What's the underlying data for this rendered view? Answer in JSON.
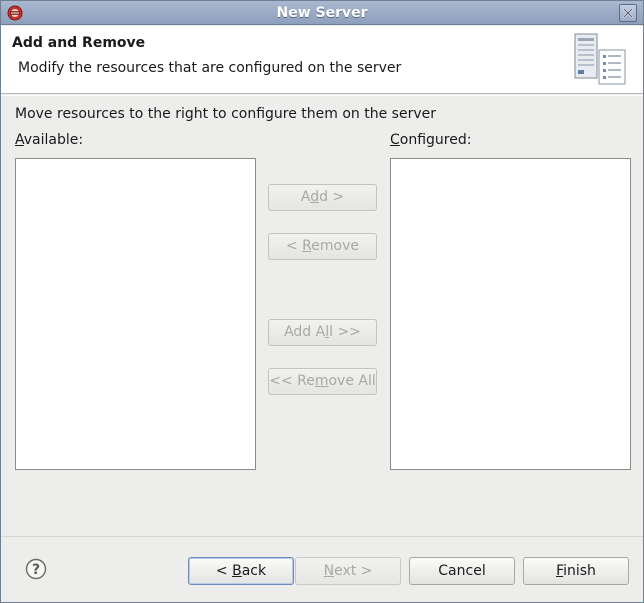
{
  "window": {
    "title": "New Server"
  },
  "header": {
    "heading": "Add and Remove",
    "description": "Modify the resources that are configured on the server"
  },
  "body": {
    "instruction": "Move resources to the right to configure them on the server",
    "available_label": {
      "mnemonic": "A",
      "rest": "vailable:"
    },
    "configured_label": {
      "mnemonic": "C",
      "rest": "onfigured:"
    },
    "available_items": [],
    "configured_items": []
  },
  "transfer_buttons": {
    "add": {
      "pre": "A",
      "mnemonic": "d",
      "post": "d >",
      "enabled": false
    },
    "remove": {
      "pre": "< ",
      "mnemonic": "R",
      "post": "emove",
      "enabled": false
    },
    "add_all": {
      "pre": "Add A",
      "mnemonic": "l",
      "post": "l >>",
      "enabled": false
    },
    "remove_all": {
      "pre": "<< Re",
      "mnemonic": "m",
      "post": "ove All",
      "enabled": false
    }
  },
  "footer": {
    "back": {
      "pre": "< ",
      "mnemonic": "B",
      "post": "ack",
      "enabled": true
    },
    "next": {
      "pre": "",
      "mnemonic": "N",
      "post": "ext >",
      "enabled": false
    },
    "cancel": {
      "label": "Cancel",
      "enabled": true
    },
    "finish": {
      "pre": "",
      "mnemonic": "F",
      "post": "inish",
      "enabled": true
    }
  },
  "icons": {
    "app": "eclipse-app-icon",
    "close": "close-icon",
    "banner": "server-wizard-icon",
    "help": "help-icon"
  },
  "colors": {
    "titlebar": "#8d9fbc",
    "header_bg": "#ffffff",
    "dialog_bg": "#ededec",
    "disabled_text": "#a8a8a6",
    "default_button_border": "#6d8bbb"
  }
}
